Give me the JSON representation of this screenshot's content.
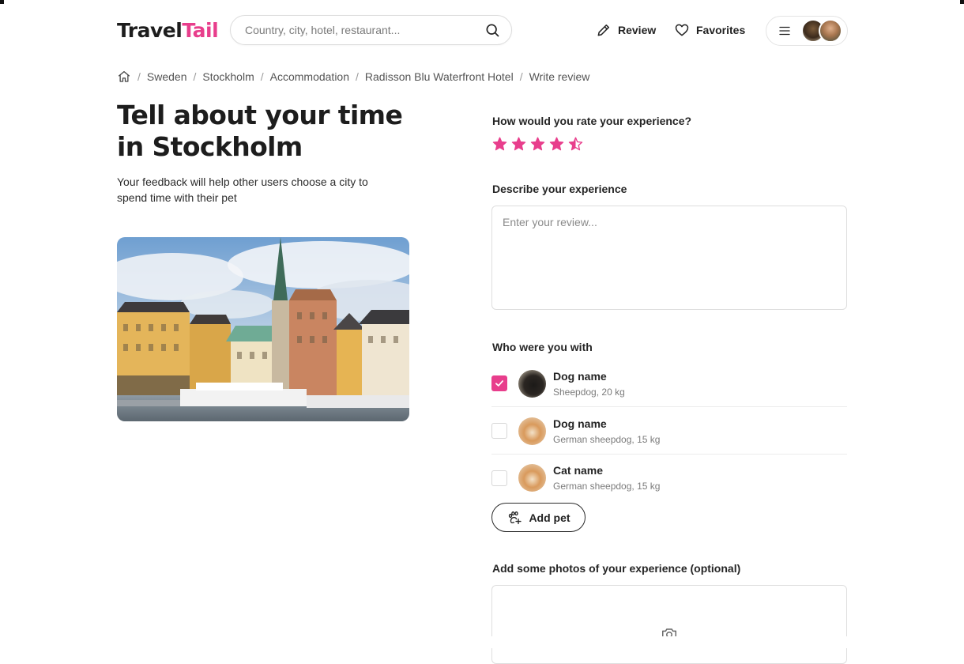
{
  "header": {
    "logo_part1": "Travel",
    "logo_part2": "Tail",
    "search_placeholder": "Country, city, hotel, restaurant...",
    "review_label": "Review",
    "favorites_label": "Favorites"
  },
  "breadcrumb": [
    "Sweden",
    "Stockholm",
    "Accommodation",
    "Radisson Blu Waterfront Hotel",
    "Write review"
  ],
  "page": {
    "title_line1": "Tell about your time",
    "title_line2": "in Stockholm",
    "subtitle": "Your feedback will help other users choose a city to spend time with their pet"
  },
  "rating": {
    "question": "How would you rate your experience?",
    "value": 4.5,
    "max": 5,
    "color": "#e83e8c"
  },
  "describe": {
    "label": "Describe your experience",
    "placeholder": "Enter your review..."
  },
  "pets": {
    "label": "Who were you with",
    "items": [
      {
        "name": "Dog name",
        "desc": "Sheepdog, 20 kg",
        "checked": true
      },
      {
        "name": "Dog name",
        "desc": "German sheepdog, 15 kg",
        "checked": false
      },
      {
        "name": "Cat name",
        "desc": "German sheepdog, 15 kg",
        "checked": false
      }
    ],
    "add_label": "Add pet"
  },
  "photos": {
    "label": "Add some photos of your experience (optional)"
  },
  "icons": {
    "search": "search-icon",
    "review": "pencil-icon",
    "favorites": "heart-icon",
    "menu": "hamburger-menu-icon",
    "home": "home-icon",
    "add_pet": "paw-plus-icon",
    "camera": "camera-icon",
    "check": "checkmark-icon"
  },
  "colors": {
    "accent": "#e83e8c",
    "text": "#1d1d1d",
    "border": "#dedede"
  }
}
